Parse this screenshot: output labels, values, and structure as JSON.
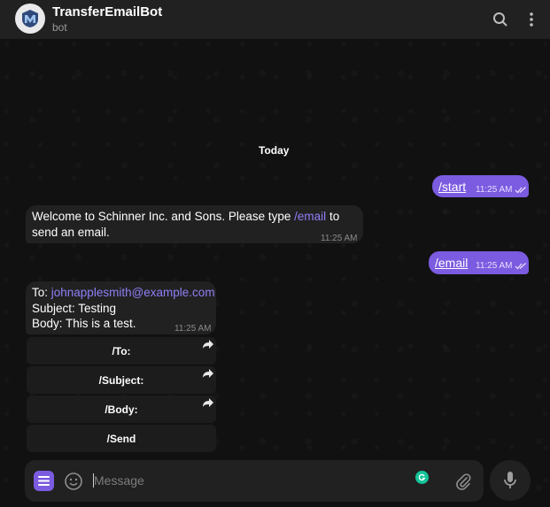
{
  "header": {
    "title": "TransferEmailBot",
    "subtitle": "bot"
  },
  "chat": {
    "date_label": "Today"
  },
  "messages": {
    "m1": {
      "text": "/start",
      "time": "11:25 AM"
    },
    "m2": {
      "pre": "Welcome to Schinner Inc. and Sons. Please type ",
      "link": "/email",
      "post": " to send an email.",
      "time": "11:25 AM"
    },
    "m3": {
      "text": "/email",
      "time": "11:25 AM"
    },
    "m4": {
      "to_label": "To: ",
      "to_value": "johnapplesmith@example.com",
      "subject": "Subject: Testing",
      "body": "Body: This is a test.",
      "time": "11:25 AM"
    }
  },
  "keyboard": {
    "b1": "/To:",
    "b2": "/Subject:",
    "b3": "/Body:",
    "b4": "/Send"
  },
  "composer": {
    "placeholder": "Message"
  },
  "colors": {
    "accent": "#7b5be0",
    "link": "#8f7ff7",
    "panel": "#212121",
    "grammarly": "#15c39a"
  }
}
